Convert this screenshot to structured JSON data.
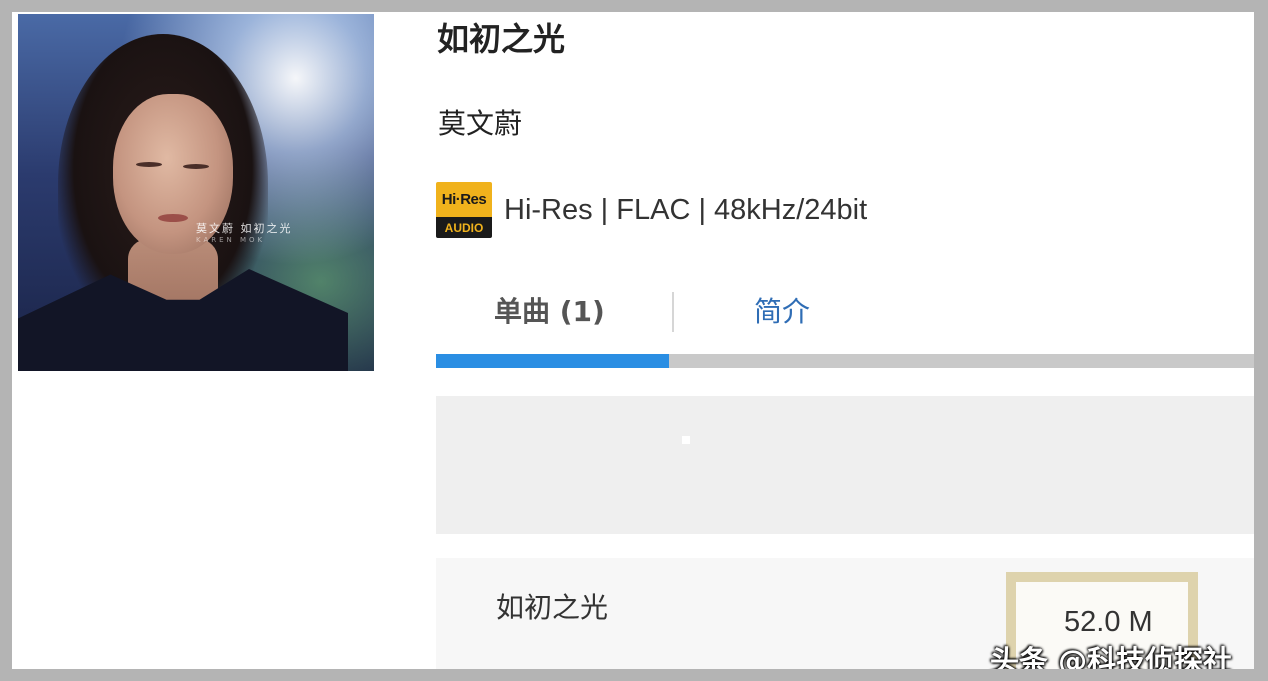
{
  "album": {
    "title": "如初之光",
    "artist": "莫文蔚",
    "cover_text": "莫文蔚  如初之光",
    "cover_subtext": "KAREN MOK"
  },
  "quality": {
    "badge_top": "Hi·Res",
    "badge_bottom": "AUDIO",
    "text": "Hi-Res | FLAC | 48kHz/24bit",
    "badge_colors": {
      "top": "#f0b21c",
      "bottom": "#1a1a1a"
    }
  },
  "tabs": {
    "items": [
      {
        "label": "单曲 (1)",
        "active": true
      },
      {
        "label": "简介",
        "active": false
      }
    ],
    "indicator_color": "#2a8ee3"
  },
  "songs": [
    {
      "name": "如初之光",
      "size": "52.0 M"
    }
  ],
  "watermark": "头条 @科技侦探社"
}
